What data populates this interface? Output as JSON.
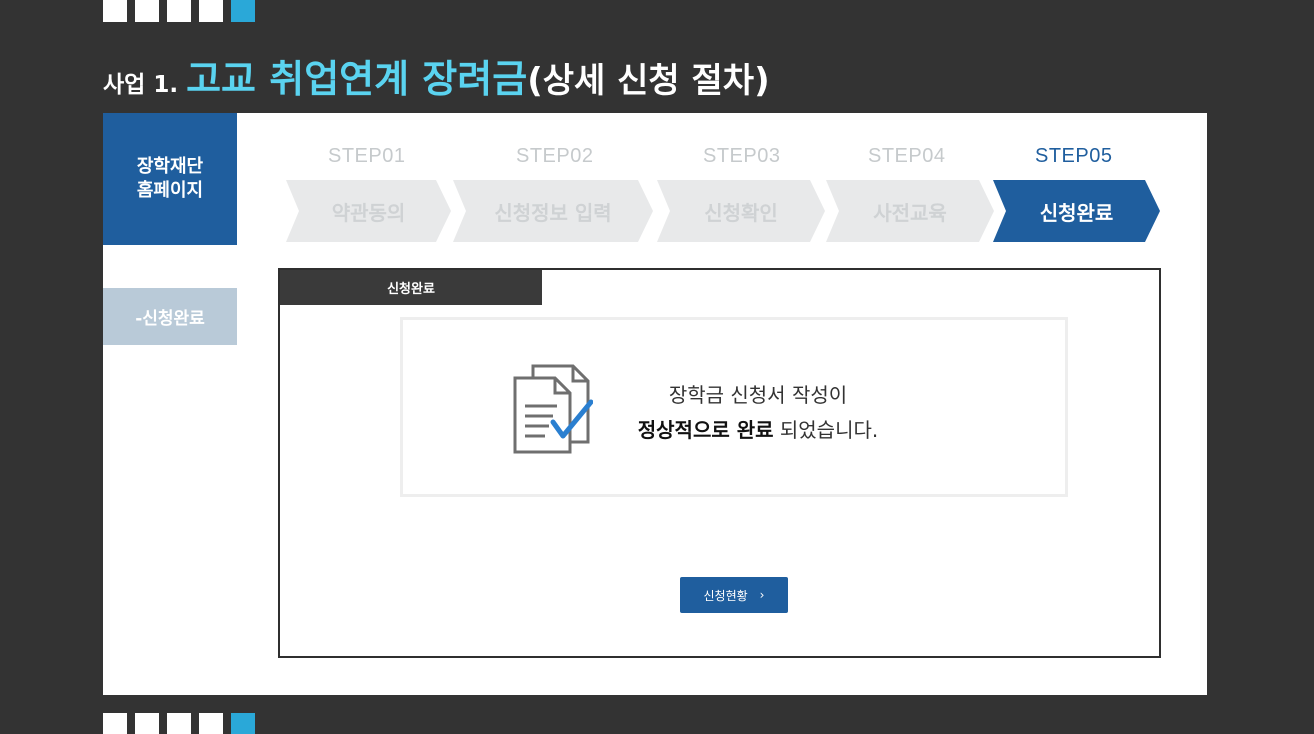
{
  "slide": {
    "title_prefix": "사업 1.",
    "title_main": "고교 취업연계 장려금",
    "title_suffix": "(상세 신청 절차)"
  },
  "sidebar": {
    "header_line1": "장학재단",
    "header_line2": "홈페이지",
    "current_item": "-신청완료"
  },
  "steps": [
    {
      "step": "STEP01",
      "label": "약관동의"
    },
    {
      "step": "STEP02",
      "label": "신청정보 입력"
    },
    {
      "step": "STEP03",
      "label": "신청확인"
    },
    {
      "step": "STEP04",
      "label": "사전교육"
    },
    {
      "step": "STEP05",
      "label": "신청완료"
    }
  ],
  "active_step": "STEP05",
  "content": {
    "tab_label": "신청완료",
    "message_line1": "장학금 신청서 작성이",
    "message_bold": "정상적으로 완료",
    "message_rest": " 되었습니다.",
    "status_button_label": "신청현황",
    "status_button_icon": "›"
  },
  "icons": {
    "document": "document-check-icon"
  },
  "colors": {
    "background": "#333333",
    "accent_title": "#5ad3f0",
    "primary_blue": "#1f5e9e",
    "sidebar_sub": "#b9cad8",
    "tab_dark": "#3a3a3a"
  }
}
